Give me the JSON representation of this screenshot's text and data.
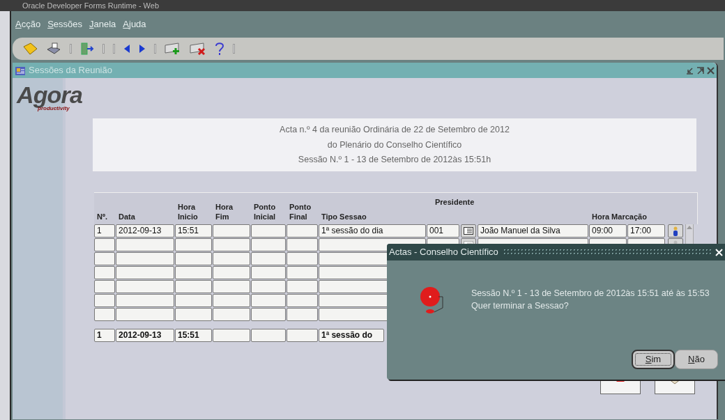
{
  "window": {
    "title": "Oracle Developer Forms Runtime - Web"
  },
  "menu": [
    "Acção",
    "Sessões",
    "Janela",
    "Ajuda"
  ],
  "toolbar": [
    {
      "kind": "save"
    },
    {
      "kind": "print"
    },
    {
      "kind": "sep"
    },
    {
      "kind": "exit"
    },
    {
      "kind": "sep"
    },
    {
      "kind": "sep"
    },
    {
      "kind": "prev"
    },
    {
      "kind": "next"
    },
    {
      "kind": "sep"
    },
    {
      "kind": "insert"
    },
    {
      "kind": "delete"
    },
    {
      "kind": "help"
    },
    {
      "kind": "sep"
    }
  ],
  "form": {
    "title": "Sessões da Reunião",
    "logo": {
      "name": "Agora",
      "tagline": "productivity"
    },
    "header_lines": [
      "Acta n.º 4 da reunião Ordinária de 22 de Setembro de 2012",
      "do Plenário do Conselho Científico",
      "Sessão N.º 1 - 13 de Setembro de 2012às 15:51h"
    ],
    "table": {
      "columns": [
        "Nº.",
        "Data",
        "Hora Inicio",
        "Hora Fim",
        "Ponto Inicial",
        "Ponto Final",
        "Tipo Sessao",
        "Presidente",
        "Hora Marcação"
      ],
      "rows": [
        {
          "n": "1",
          "data": "2012-09-13",
          "hora_inicio": "15:51",
          "tipo_sessao": "1ª sessão do dia",
          "presidente_codigo": "001",
          "presidente_nome": "João Manuel da Silva",
          "marcacao_inicio": "09:00",
          "marcacao_fim": "17:00"
        },
        {},
        {},
        {},
        {},
        {},
        {}
      ],
      "current": {
        "n": "1",
        "data": "2012-09-13",
        "hora_inicio": "15:51",
        "tipo_sessao": "1ª sessão do"
      }
    }
  },
  "dialog": {
    "title": "Actas - Conselho Científico",
    "message": [
      "Sessão N.º 1 - 13 de Setembro de 2012às 15:51 até às 15:53",
      "Quer terminar a Sessao?"
    ],
    "buttons": [
      {
        "label": "Sim",
        "selected": true
      },
      {
        "label": "Não",
        "selected": false
      }
    ]
  }
}
